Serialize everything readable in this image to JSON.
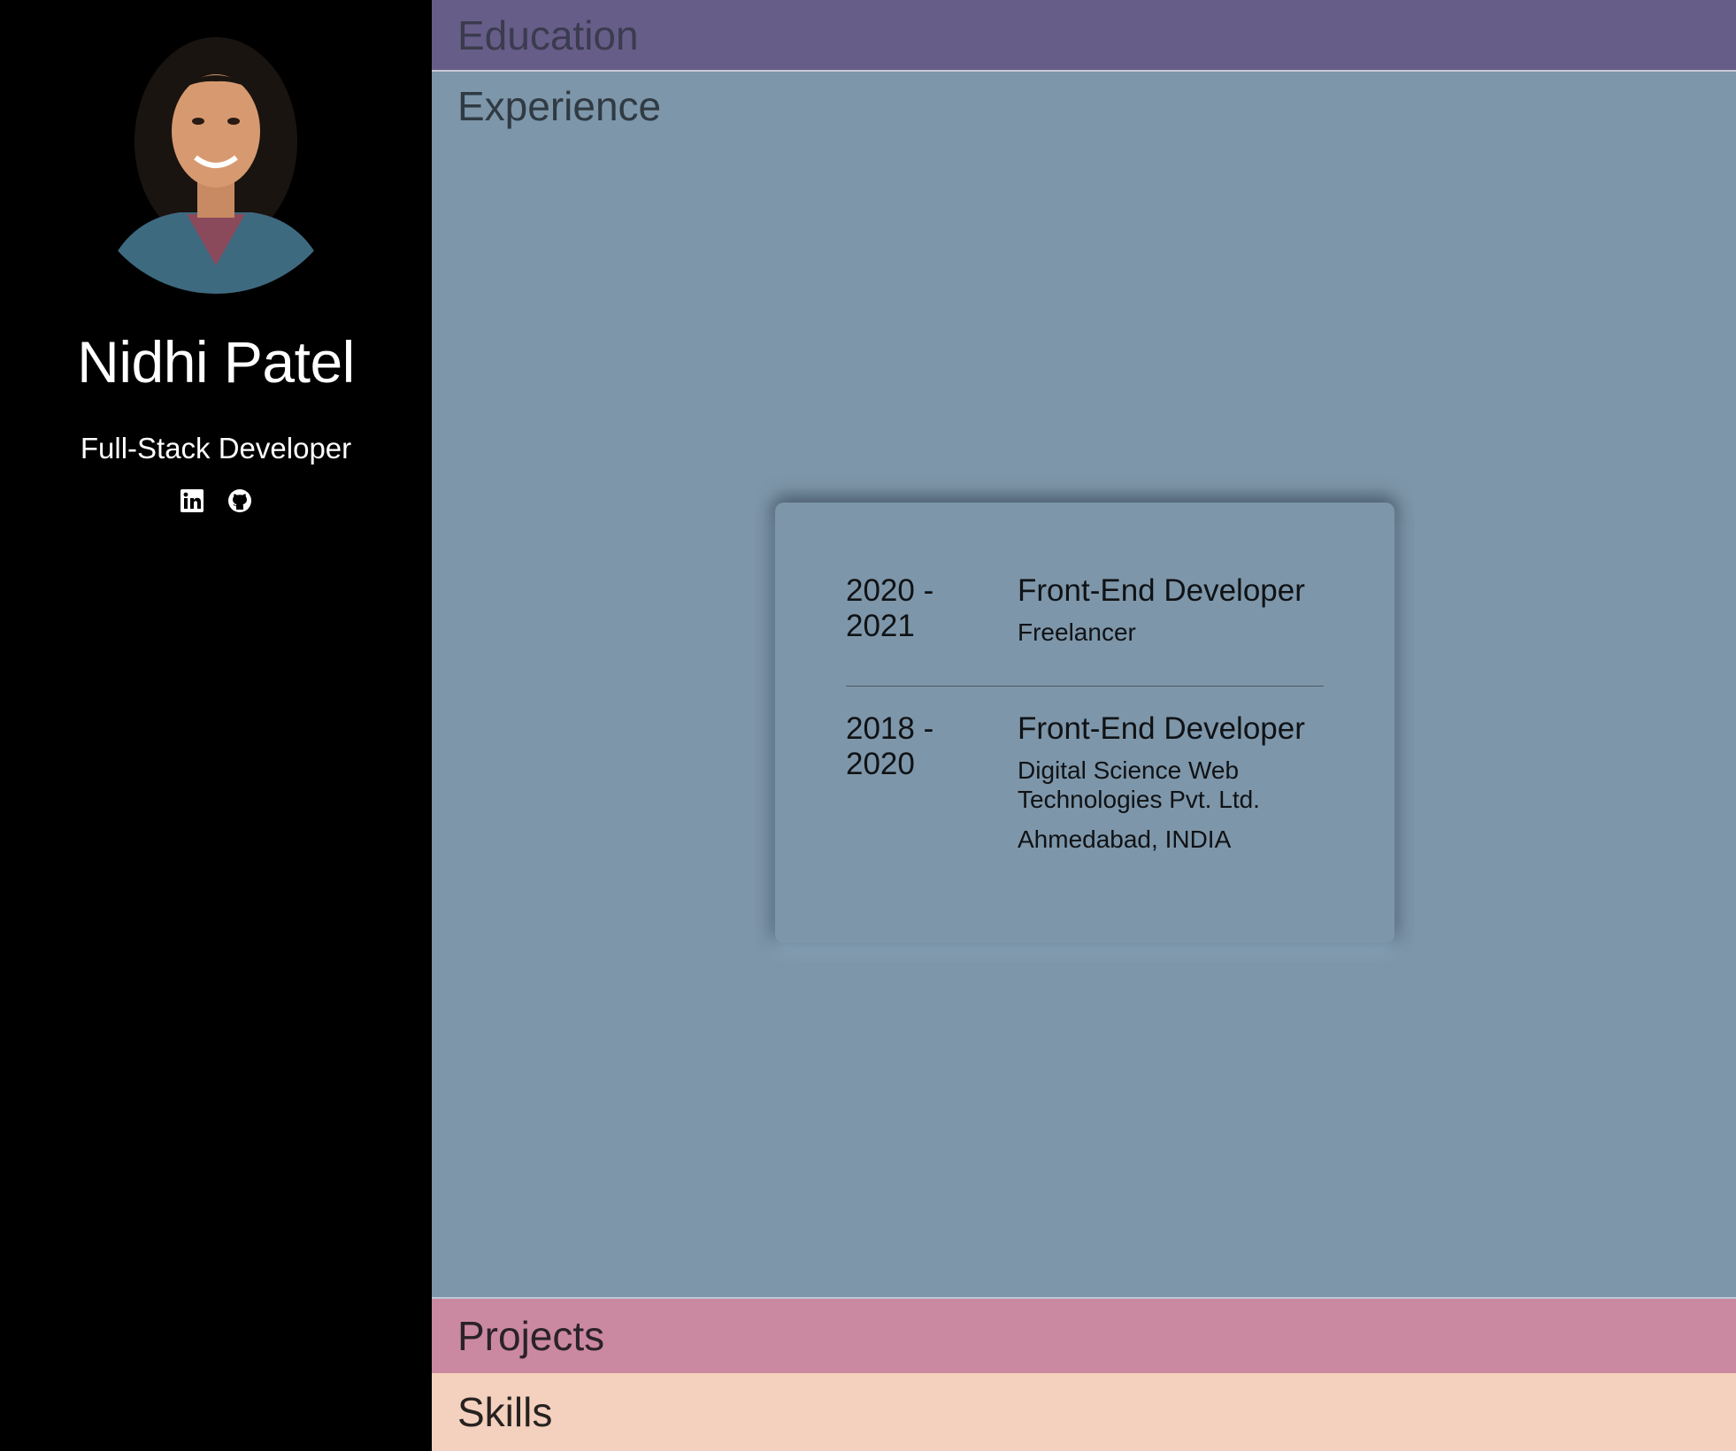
{
  "profile": {
    "name": "Nidhi Patel",
    "role": "Full-Stack Developer",
    "socials": [
      {
        "icon": "linkedin-icon"
      },
      {
        "icon": "github-icon"
      }
    ]
  },
  "sections": {
    "education": "Education",
    "experience": "Experience",
    "projects": "Projects",
    "skills": "Skills"
  },
  "experience": [
    {
      "date_start": "2020 -",
      "date_end": "2021",
      "title": "Front-End Developer",
      "company": "Freelancer",
      "location": ""
    },
    {
      "date_start": "2018 -",
      "date_end": "2020",
      "title": "Front-End Developer",
      "company": "Digital Science Web Technologies Pvt. Ltd.",
      "location": "Ahmedabad, INDIA"
    }
  ],
  "colors": {
    "sidebar": "#000000",
    "education": "#665e88",
    "experience": "#7e96a9",
    "projects": "#cb89a1",
    "skills": "#f4d0be"
  }
}
